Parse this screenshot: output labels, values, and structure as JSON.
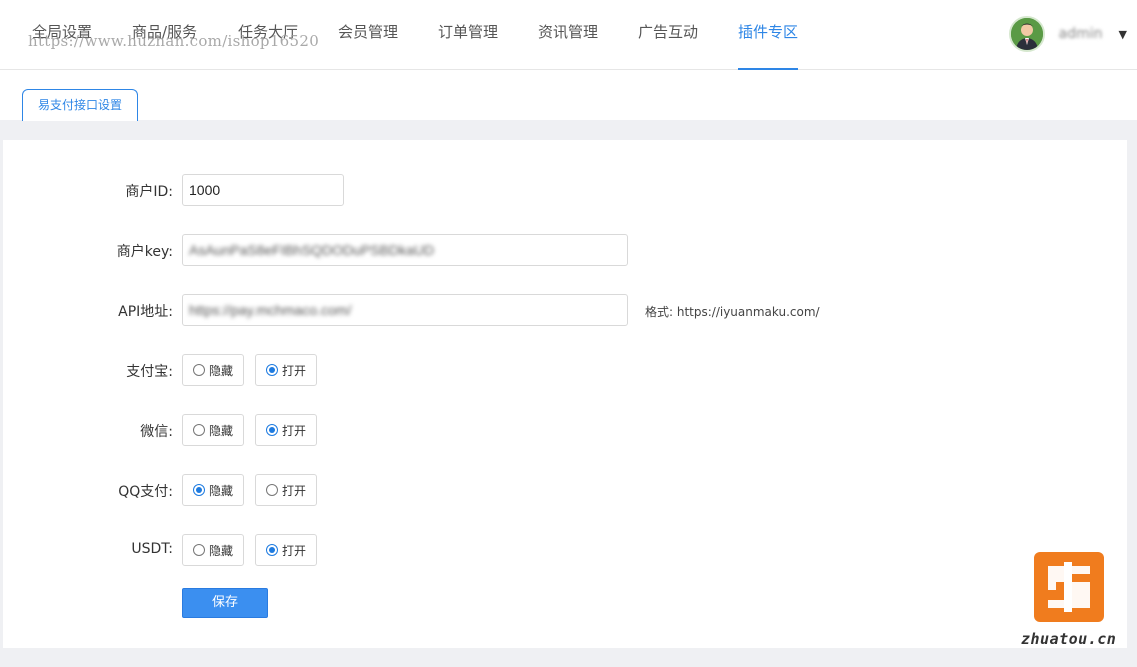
{
  "nav": {
    "items": [
      "全局设置",
      "商品/服务",
      "任务大厅",
      "会员管理",
      "订单管理",
      "资讯管理",
      "广告互动",
      "插件专区"
    ],
    "active": "插件专区"
  },
  "watermark_top": "https://www.huzhan.com/ishop16520",
  "user": {
    "name": "admin",
    "caret": "▼"
  },
  "tab": {
    "label": "易支付接口设置"
  },
  "form": {
    "merchant_id": {
      "label": "商户ID:",
      "value": "1000"
    },
    "merchant_key": {
      "label": "商户key:",
      "value": "AsAunPaS8eFIBhSQDODuPSBDkaUD"
    },
    "api_url": {
      "label": "API地址:",
      "value": "https://pay.mchmaco.com/",
      "hint": "格式: https://iyuanmaku.com/"
    },
    "alipay": {
      "label": "支付宝:",
      "hide": "隐藏",
      "open": "打开",
      "selected": "open"
    },
    "wechat": {
      "label": "微信:",
      "hide": "隐藏",
      "open": "打开",
      "selected": "open"
    },
    "qqpay": {
      "label": "QQ支付:",
      "hide": "隐藏",
      "open": "打开",
      "selected": "hide"
    },
    "usdt": {
      "label": "USDT:",
      "hide": "隐藏",
      "open": "打开",
      "selected": "open"
    },
    "save_label": "保存"
  },
  "watermark_logo": {
    "text": "zhuatou.cn",
    "color": "#f07c1e"
  }
}
